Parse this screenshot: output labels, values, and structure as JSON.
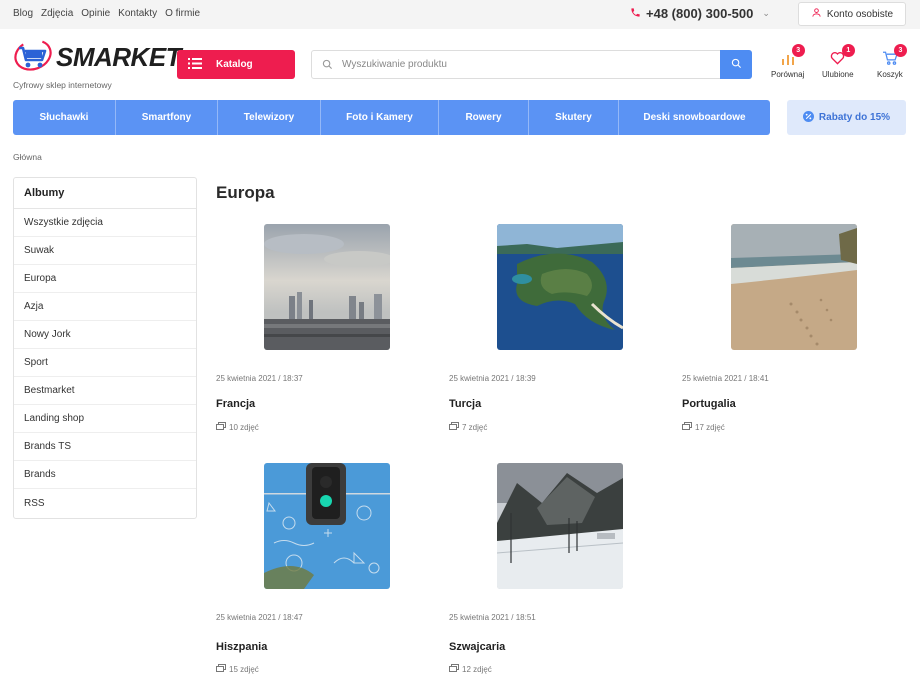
{
  "topbar": {
    "links": [
      "Blog",
      "Zdjęcia",
      "Opinie",
      "Kontakty",
      "O firmie"
    ],
    "phone": "+48 (800) 300-500",
    "account_label": "Konto osobiste"
  },
  "header": {
    "logo_text": "SMARKET",
    "tagline": "Cyfrowy sklep internetowy",
    "catalog_label": "Katalog",
    "search_placeholder": "Wyszukiwanie produktu",
    "icons": [
      {
        "label": "Porównaj",
        "badge": "3",
        "icon": "chart-icon"
      },
      {
        "label": "Ulubione",
        "badge": "1",
        "icon": "heart-icon"
      },
      {
        "label": "Koszyk",
        "badge": "3",
        "icon": "cart-icon"
      }
    ]
  },
  "categories": [
    "Słuchawki",
    "Smartfony",
    "Telewizory",
    "Foto i Kamery",
    "Rowery",
    "Skutery",
    "Deski snowboardowe"
  ],
  "promo_label": "Rabaty do 15%",
  "breadcrumb": "Główna",
  "sidebar": {
    "title": "Albumy",
    "items": [
      "Wszystkie zdjęcia",
      "Suwak",
      "Europa",
      "Azja",
      "Nowy Jork",
      "Sport",
      "Bestmarket",
      "Landing shop",
      "Brands TS",
      "Brands",
      "RSS"
    ]
  },
  "main": {
    "title": "Europa",
    "albums": [
      {
        "name": "Francja",
        "date": "25 kwietnia 2021 / 18:37",
        "count": "10 zdjęć"
      },
      {
        "name": "Turcja",
        "date": "25 kwietnia 2021 / 18:39",
        "count": "7 zdjęć"
      },
      {
        "name": "Portugalia",
        "date": "25 kwietnia 2021 / 18:41",
        "count": "17 zdjęć"
      },
      {
        "name": "Hiszpania",
        "date": "25 kwietnia 2021 / 18:47",
        "count": "15 zdjęć"
      },
      {
        "name": "Szwajcaria",
        "date": "25 kwietnia 2021 / 18:51",
        "count": "12 zdjęć"
      }
    ]
  },
  "colors": {
    "accent_red": "#ee1d4f",
    "accent_blue": "#5b93f4",
    "promo_bg": "#dfe9fb"
  }
}
